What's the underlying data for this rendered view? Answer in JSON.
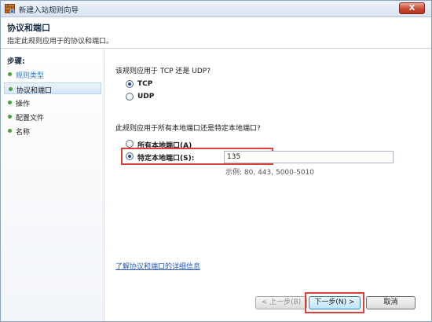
{
  "window": {
    "title": "新建入站规则向导",
    "close_label": "X"
  },
  "header": {
    "title": "协议和端口",
    "subtitle": "指定此规则应用于的协议和端口。"
  },
  "sidebar": {
    "steps_label": "步骤:",
    "items": [
      {
        "label": "规则类型",
        "state": "done"
      },
      {
        "label": "协议和端口",
        "state": "current"
      },
      {
        "label": "操作",
        "state": "pending"
      },
      {
        "label": "配置文件",
        "state": "pending"
      },
      {
        "label": "名称",
        "state": "pending"
      }
    ]
  },
  "main": {
    "protocol_question": "该规则应用于 TCP 还是 UDP?",
    "protocol_options": [
      {
        "label": "TCP",
        "checked": true
      },
      {
        "label": "UDP",
        "checked": false
      }
    ],
    "port_question": "此规则应用于所有本地端口还是特定本地端口?",
    "port_options": [
      {
        "label": "所有本地端口(A)",
        "checked": false
      },
      {
        "label": "特定本地端口(S):",
        "checked": true
      }
    ],
    "port_value": "135",
    "port_example": "示例: 80, 443, 5000-5010",
    "learn_more_link": "了解协议和端口的详细信息"
  },
  "buttons": {
    "back": "< 上一步(B)",
    "next": "下一步(N) >",
    "cancel": "取消"
  },
  "colors": {
    "highlight": "#d9413a",
    "link": "#2a58b3",
    "accent": "#2f7bc6"
  }
}
